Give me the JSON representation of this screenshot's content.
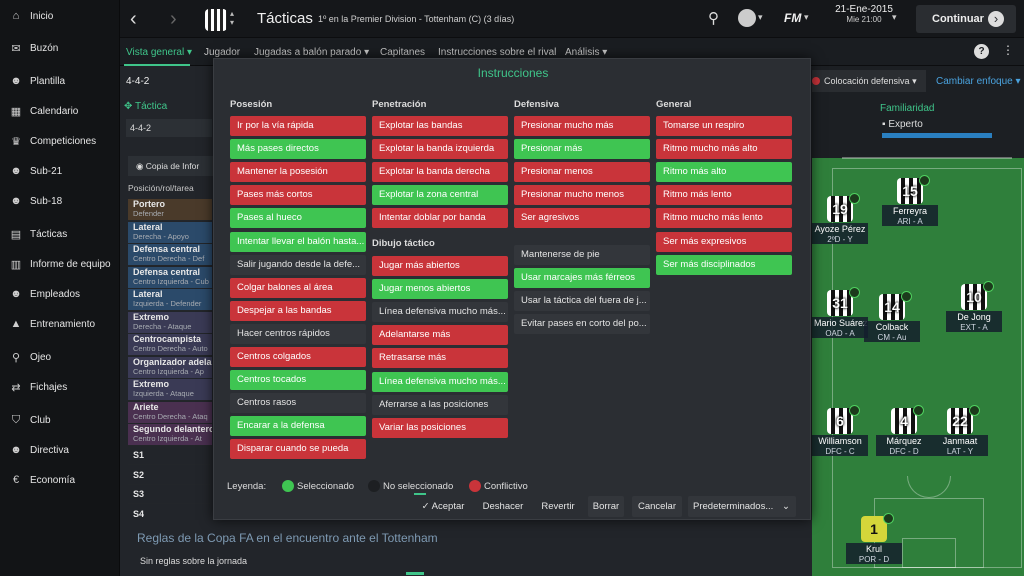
{
  "sidebar": {
    "items": [
      "Inicio",
      "Buzón",
      "Plantilla",
      "Calendario",
      "Competiciones",
      "Sub-21",
      "Sub-18",
      "Tácticas",
      "Informe de equipo",
      "Empleados",
      "Entrenamiento",
      "Ojeo",
      "Fichajes",
      "Club",
      "Directiva",
      "Economía"
    ]
  },
  "topbar": {
    "title": "Tácticas",
    "subtitle": "1º en la Premier Division - Tottenham (C) (3 días)",
    "date": "21-Ene-2015",
    "time": "Mie 21:00",
    "continue": "Continuar",
    "fm": "FM"
  },
  "subnav": {
    "tabs": [
      "Vista general",
      "Jugador",
      "Jugadas a balón parado",
      "Capitanes",
      "Instrucciones sobre el rival",
      "Análisis"
    ],
    "help": "?"
  },
  "left": {
    "formation": "4-4-2",
    "tactic_label": "Táctica",
    "tactic_value": "4-4-2",
    "copy": "Copia de Infor",
    "header": "Posición/rol/tarea",
    "rows": [
      {
        "a": "Portero",
        "b": "Defender"
      },
      {
        "a": "Lateral",
        "b": "Derecha - Apoyo"
      },
      {
        "a": "Defensa central",
        "b": "Centro Derecha - Def"
      },
      {
        "a": "Defensa central",
        "b": "Centro Izquierda - Cub"
      },
      {
        "a": "Lateral",
        "b": "Izquierda - Defender"
      },
      {
        "a": "Extremo",
        "b": "Derecha - Ataque"
      },
      {
        "a": "Centrocampista",
        "b": "Centro Derecha - Auto"
      },
      {
        "a": "Organizador adela",
        "b": "Centro Izquierda - Ap"
      },
      {
        "a": "Extremo",
        "b": "Izquierda - Ataque"
      },
      {
        "a": "Ariete",
        "b": "Centro Derecha - Ataq"
      },
      {
        "a": "Segundo delantero",
        "b": "Centro Izquierda - At"
      }
    ],
    "subs": [
      "S1",
      "S2",
      "S3",
      "S4"
    ]
  },
  "right": {
    "defensive": "Colocación defensiva",
    "change": "Cambiar enfoque",
    "familiarity": "Familiaridad",
    "level": "Experto"
  },
  "bottom": {
    "title": "Reglas de la Copa FA en el encuentro ante el Tottenham",
    "text": "Sin reglas sobre la jornada"
  },
  "modal": {
    "title": "Instrucciones",
    "col_posesion": "Posesión",
    "col_penetracion": "Penetración",
    "col_defensiva": "Defensiva",
    "col_general": "General",
    "sub_dibujo": "Dibujo táctico",
    "posesion": [
      {
        "t": "Ir por la vía rápida",
        "s": "red"
      },
      {
        "t": "Más pases directos",
        "s": "green"
      },
      {
        "t": "Mantener la posesión",
        "s": "red"
      },
      {
        "t": "Pases más cortos",
        "s": "red"
      },
      {
        "t": "Pases al hueco",
        "s": "green"
      },
      {
        "t": "Intentar llevar el balón hasta...",
        "s": "green"
      },
      {
        "t": "Salir jugando desde la defe...",
        "s": "dark"
      },
      {
        "t": "Colgar balones al área",
        "s": "red"
      },
      {
        "t": "Despejar a las bandas",
        "s": "red"
      },
      {
        "t": "Hacer centros rápidos",
        "s": "dark"
      },
      {
        "t": "Centros colgados",
        "s": "red"
      },
      {
        "t": "Centros tocados",
        "s": "green"
      },
      {
        "t": "Centros rasos",
        "s": "dark"
      },
      {
        "t": "Encarar a la defensa",
        "s": "green"
      },
      {
        "t": "Disparar cuando se pueda",
        "s": "red"
      }
    ],
    "penetracion": [
      {
        "t": "Explotar las bandas",
        "s": "red"
      },
      {
        "t": "Explotar la banda izquierda",
        "s": "red"
      },
      {
        "t": "Explotar la banda derecha",
        "s": "red"
      },
      {
        "t": "Explotar la zona central",
        "s": "green"
      },
      {
        "t": "Intentar doblar por banda",
        "s": "red"
      }
    ],
    "dibujo": [
      {
        "t": "Jugar más abiertos",
        "s": "red"
      },
      {
        "t": "Jugar menos abiertos",
        "s": "green"
      },
      {
        "t": "Línea defensiva mucho más...",
        "s": "dark"
      },
      {
        "t": "Adelantarse más",
        "s": "red"
      },
      {
        "t": "Retrasarse más",
        "s": "red"
      },
      {
        "t": "Línea defensiva mucho más...",
        "s": "green"
      },
      {
        "t": "Aferrarse a las posiciones",
        "s": "dark"
      },
      {
        "t": "Variar las posiciones",
        "s": "red"
      }
    ],
    "defensiva": [
      {
        "t": "Presionar mucho más",
        "s": "red"
      },
      {
        "t": "Presionar más",
        "s": "green"
      },
      {
        "t": "Presionar menos",
        "s": "red"
      },
      {
        "t": "Presionar mucho menos",
        "s": "red"
      },
      {
        "t": "Ser agresivos",
        "s": "red"
      },
      {
        "t": "Mantenerse de pie",
        "s": "dark"
      },
      {
        "t": "Usar marcajes más férreos",
        "s": "green"
      },
      {
        "t": "Usar la táctica del fuera de j...",
        "s": "dark"
      },
      {
        "t": "Evitar pases en corto del po...",
        "s": "dark"
      }
    ],
    "general": [
      {
        "t": "Tomarse un respiro",
        "s": "red"
      },
      {
        "t": "Ritmo mucho más alto",
        "s": "red"
      },
      {
        "t": "Ritmo más alto",
        "s": "green"
      },
      {
        "t": "Ritmo más lento",
        "s": "red"
      },
      {
        "t": "Ritmo mucho más lento",
        "s": "red"
      },
      {
        "t": "Ser más expresivos",
        "s": "red"
      },
      {
        "t": "Ser más disciplinados",
        "s": "green"
      }
    ],
    "legend": {
      "label": "Leyenda:",
      "selected": "Seleccionado",
      "not_selected": "No seleccionado",
      "conflict": "Conflictivo"
    },
    "buttons": {
      "accept": "Aceptar",
      "undo": "Deshacer",
      "revert": "Revertir",
      "delete": "Borrar",
      "cancel": "Cancelar",
      "defaults": "Predeterminados..."
    },
    "colors": {
      "red": "#c9343a",
      "green": "#3fc552",
      "dark": "#33363b"
    }
  },
  "players": [
    {
      "num": "15",
      "name": "Ferreyra",
      "role": "ARI - A"
    },
    {
      "num": "19",
      "name": "Ayoze Pérez",
      "role": "2ºD - Y"
    },
    {
      "num": "31",
      "name": "Mario Suárez",
      "role": "OAD - A"
    },
    {
      "num": "14",
      "name": "Colback",
      "role": "CM - Au"
    },
    {
      "num": "10",
      "name": "De Jong",
      "role": "EXT - A"
    },
    {
      "num": "6",
      "name": "Williamson",
      "role": "DFC - C"
    },
    {
      "num": "4",
      "name": "Márquez",
      "role": "DFC - D"
    },
    {
      "num": "22",
      "name": "Janmaat",
      "role": "LAT - Y"
    },
    {
      "num": "1",
      "name": "Krul",
      "role": "POR - D"
    }
  ]
}
